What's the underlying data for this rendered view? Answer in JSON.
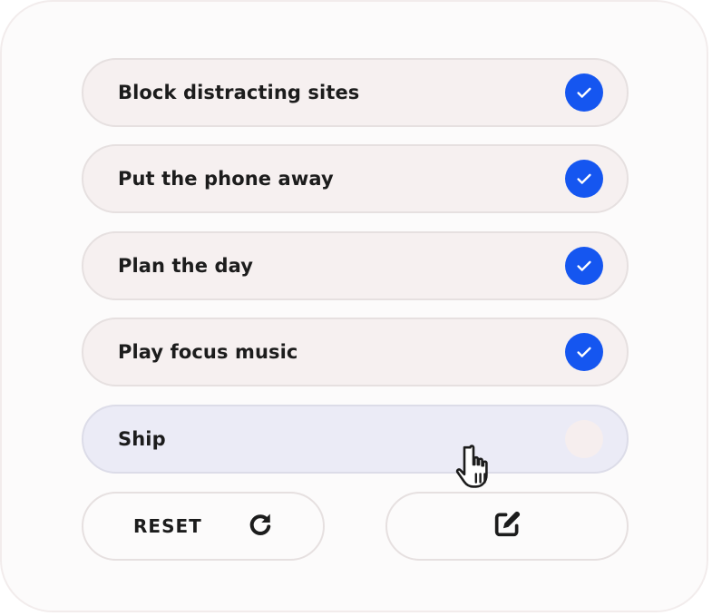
{
  "tasks": [
    {
      "label": "Block distracting sites",
      "checked": true
    },
    {
      "label": "Put the phone away",
      "checked": true
    },
    {
      "label": "Plan the day",
      "checked": true
    },
    {
      "label": "Play focus music",
      "checked": true
    },
    {
      "label": "Ship",
      "checked": false
    }
  ],
  "actions": {
    "reset_label": "RESET",
    "reset_icon": "refresh-icon",
    "edit_icon": "edit-icon"
  },
  "colors": {
    "check_accent": "#1556f0",
    "item_background": "#f6f0f0",
    "item_hover_background": "#ebebf6",
    "text": "#1c1c1c"
  },
  "cursor": "pointer-hand-icon"
}
